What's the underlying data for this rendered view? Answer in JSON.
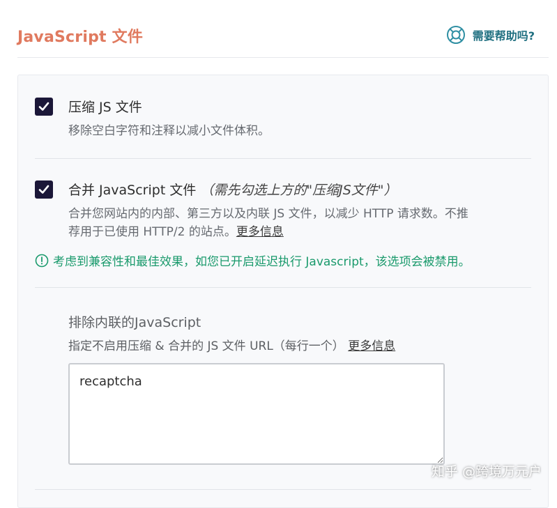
{
  "header": {
    "title": "JavaScript 文件",
    "help_label": "需要帮助吗?",
    "help_icon": "lifebuoy-icon"
  },
  "options": {
    "minify": {
      "checked": true,
      "label": "压缩 JS 文件",
      "description": "移除空白字符和注释以减小文件体积。"
    },
    "combine": {
      "checked": true,
      "label": "合并 JavaScript 文件",
      "note": "（需先勾选上方的\"压缩JS文件\"）",
      "description_line1": "合并您网站内的内部、第三方以及内联 JS 文件，以减少 HTTP 请求数。不推",
      "description_line2": "荐用于已使用 HTTP/2 的站点。",
      "more_info": "更多信息",
      "warning": "考虑到兼容性和最佳效果，如您已开启延迟执行 Javascript，该选项会被禁用。"
    }
  },
  "exclude_inline": {
    "title": "排除内联的JavaScript",
    "description": "指定不启用压缩 & 合并的 JS 文件 URL（每行一个）",
    "more_info": "更多信息",
    "textarea_value": "recaptcha"
  },
  "watermark": "知乎 @跨境万元户",
  "colors": {
    "title": "#e07a5f",
    "help": "#1f6f80",
    "checkbox": "#1b1738",
    "warning": "#1a9a6c"
  }
}
